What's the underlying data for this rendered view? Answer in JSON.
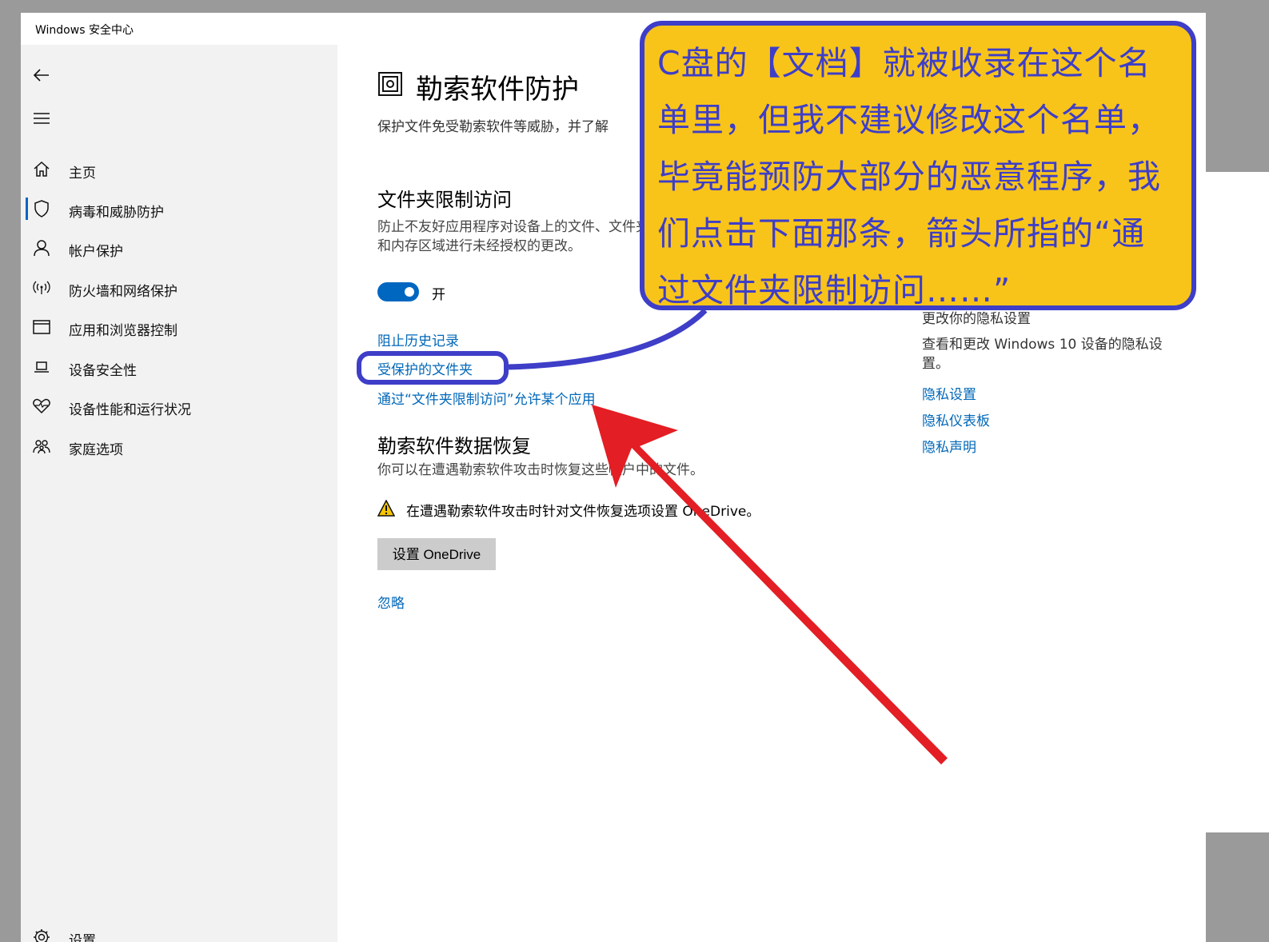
{
  "window": {
    "title": "Windows 安全中心"
  },
  "sidebar": {
    "items": [
      {
        "label": "主页",
        "icon": "home-icon"
      },
      {
        "label": "病毒和威胁防护",
        "icon": "shield-icon",
        "active": true
      },
      {
        "label": "帐户保护",
        "icon": "person-icon"
      },
      {
        "label": "防火墙和网络保护",
        "icon": "wireless-icon"
      },
      {
        "label": "应用和浏览器控制",
        "icon": "browser-window-icon"
      },
      {
        "label": "设备安全性",
        "icon": "laptop-icon"
      },
      {
        "label": "设备性能和运行状况",
        "icon": "heart-icon"
      },
      {
        "label": "家庭选项",
        "icon": "family-icon"
      }
    ],
    "settings_label": "设置"
  },
  "main": {
    "title": "勒索软件防护",
    "description": "保护文件免受勒索软件等威胁，并了解",
    "folder_access": {
      "title": "文件夹限制访问",
      "description": "防止不友好应用程序对设备上的文件、文件夹和内存区域进行未经授权的更改。",
      "toggle_label": "开",
      "toggle_on": true,
      "links": {
        "block_history": "阻止历史记录",
        "protected_folders": "受保护的文件夹",
        "allow_app": "通过“文件夹限制访问”允许某个应用"
      }
    },
    "recovery": {
      "title": "勒索软件数据恢复",
      "description": "你可以在遭遇勒索软件攻击时恢复这些帐户中的文件。",
      "warning": "在遭遇勒索软件攻击时针对文件恢复选项设置 OneDrive。",
      "setup_button": "设置 OneDrive",
      "dismiss_link": "忽略"
    }
  },
  "right_column": {
    "partial_heading": "更改你的隐私设置",
    "privacy_description": "查看和更改 Windows 10 设备的隐私设置。",
    "links": [
      "隐私设置",
      "隐私仪表板",
      "隐私声明"
    ]
  },
  "annotation": {
    "callout_text": "C盘的【文档】就被收录在这个名单里，但我不建议修改这个名单，毕竟能预防大部分的恶意程序，我们点击下面那条，箭头所指的“通过文件夹限制访问……”",
    "callout_bg": "#f8c419",
    "callout_border": "#3e3ec8",
    "arrow_color": "#e31e24"
  },
  "colors": {
    "accent": "#0067c0",
    "link": "#0067b8",
    "sidebar_bg": "#f2f2f2"
  }
}
